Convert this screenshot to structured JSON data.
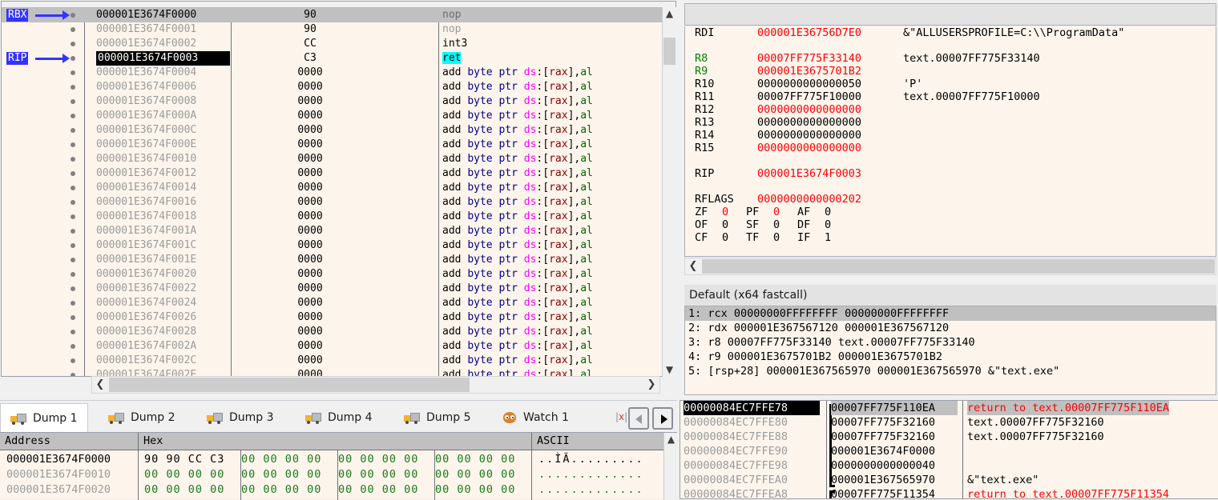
{
  "cpu": {
    "gutter_labels": [
      {
        "text": "RBX",
        "row": 0
      },
      {
        "text": "RIP",
        "row": 3
      }
    ],
    "rows": [
      {
        "addr": "000001E3674F0000",
        "bytes": "90",
        "op": "nop",
        "kind": "nop",
        "state": "selected"
      },
      {
        "addr": "000001E3674F0001",
        "bytes": "90",
        "op": "nop",
        "kind": "nop",
        "state": "normal"
      },
      {
        "addr": "000001E3674F0002",
        "bytes": "CC",
        "op": "int3",
        "kind": "plain",
        "state": "normal"
      },
      {
        "addr": "000001E3674F0003",
        "bytes": "C3",
        "op": "ret",
        "kind": "ret",
        "state": "current"
      },
      {
        "addr": "000001E3674F0004",
        "bytes": "0000",
        "op": "add byte ptr ds:[rax],al",
        "kind": "add",
        "state": "normal"
      },
      {
        "addr": "000001E3674F0006",
        "bytes": "0000",
        "op": "add byte ptr ds:[rax],al",
        "kind": "add",
        "state": "normal"
      },
      {
        "addr": "000001E3674F0008",
        "bytes": "0000",
        "op": "add byte ptr ds:[rax],al",
        "kind": "add",
        "state": "normal"
      },
      {
        "addr": "000001E3674F000A",
        "bytes": "0000",
        "op": "add byte ptr ds:[rax],al",
        "kind": "add",
        "state": "normal"
      },
      {
        "addr": "000001E3674F000C",
        "bytes": "0000",
        "op": "add byte ptr ds:[rax],al",
        "kind": "add",
        "state": "normal"
      },
      {
        "addr": "000001E3674F000E",
        "bytes": "0000",
        "op": "add byte ptr ds:[rax],al",
        "kind": "add",
        "state": "normal"
      },
      {
        "addr": "000001E3674F0010",
        "bytes": "0000",
        "op": "add byte ptr ds:[rax],al",
        "kind": "add",
        "state": "normal"
      },
      {
        "addr": "000001E3674F0012",
        "bytes": "0000",
        "op": "add byte ptr ds:[rax],al",
        "kind": "add",
        "state": "normal"
      },
      {
        "addr": "000001E3674F0014",
        "bytes": "0000",
        "op": "add byte ptr ds:[rax],al",
        "kind": "add",
        "state": "normal"
      },
      {
        "addr": "000001E3674F0016",
        "bytes": "0000",
        "op": "add byte ptr ds:[rax],al",
        "kind": "add",
        "state": "normal"
      },
      {
        "addr": "000001E3674F0018",
        "bytes": "0000",
        "op": "add byte ptr ds:[rax],al",
        "kind": "add",
        "state": "normal"
      },
      {
        "addr": "000001E3674F001A",
        "bytes": "0000",
        "op": "add byte ptr ds:[rax],al",
        "kind": "add",
        "state": "normal"
      },
      {
        "addr": "000001E3674F001C",
        "bytes": "0000",
        "op": "add byte ptr ds:[rax],al",
        "kind": "add",
        "state": "normal"
      },
      {
        "addr": "000001E3674F001E",
        "bytes": "0000",
        "op": "add byte ptr ds:[rax],al",
        "kind": "add",
        "state": "normal"
      },
      {
        "addr": "000001E3674F0020",
        "bytes": "0000",
        "op": "add byte ptr ds:[rax],al",
        "kind": "add",
        "state": "normal"
      },
      {
        "addr": "000001E3674F0022",
        "bytes": "0000",
        "op": "add byte ptr ds:[rax],al",
        "kind": "add",
        "state": "normal"
      },
      {
        "addr": "000001E3674F0024",
        "bytes": "0000",
        "op": "add byte ptr ds:[rax],al",
        "kind": "add",
        "state": "normal"
      },
      {
        "addr": "000001E3674F0026",
        "bytes": "0000",
        "op": "add byte ptr ds:[rax],al",
        "kind": "add",
        "state": "normal"
      },
      {
        "addr": "000001E3674F0028",
        "bytes": "0000",
        "op": "add byte ptr ds:[rax],al",
        "kind": "add",
        "state": "normal"
      },
      {
        "addr": "000001E3674F002A",
        "bytes": "0000",
        "op": "add byte ptr ds:[rax],al",
        "kind": "add",
        "state": "normal"
      },
      {
        "addr": "000001E3674F002C",
        "bytes": "0000",
        "op": "add byte ptr ds:[rax],al",
        "kind": "add",
        "state": "normal"
      },
      {
        "addr": "000001E3674F002E",
        "bytes": "0000",
        "op": "add byte ptr ds:[rax],al",
        "kind": "add",
        "state": "normal"
      }
    ]
  },
  "registers": {
    "rows": [
      {
        "name": "RDI",
        "value": "000001E36756D7E0",
        "comment": "&\"ALLUSERSPROFILE=C:\\\\ProgramData\"",
        "name_mod": false,
        "value_mod": true
      },
      {
        "name": "",
        "value": "",
        "comment": "",
        "name_mod": false,
        "value_mod": false
      },
      {
        "name": "R8",
        "value": "00007FF775F33140",
        "comment": "text.00007FF775F33140",
        "name_mod": true,
        "value_mod": true
      },
      {
        "name": "R9",
        "value": "000001E3675701B2",
        "comment": "",
        "name_mod": true,
        "value_mod": true
      },
      {
        "name": "R10",
        "value": "0000000000000050",
        "comment": "'P'",
        "name_mod": false,
        "value_mod": false
      },
      {
        "name": "R11",
        "value": "00007FF775F10000",
        "comment": "text.00007FF775F10000",
        "name_mod": false,
        "value_mod": false
      },
      {
        "name": "R12",
        "value": "0000000000000000",
        "comment": "",
        "name_mod": false,
        "value_mod": true
      },
      {
        "name": "R13",
        "value": "0000000000000000",
        "comment": "",
        "name_mod": false,
        "value_mod": false
      },
      {
        "name": "R14",
        "value": "0000000000000000",
        "comment": "",
        "name_mod": false,
        "value_mod": false
      },
      {
        "name": "R15",
        "value": "0000000000000000",
        "comment": "",
        "name_mod": false,
        "value_mod": true
      },
      {
        "name": "",
        "value": "",
        "comment": "",
        "name_mod": false,
        "value_mod": false
      },
      {
        "name": "RIP",
        "value": "000001E3674F0003",
        "comment": "",
        "name_mod": false,
        "value_mod": true
      }
    ],
    "rflags_label": "RFLAGS",
    "rflags_value": "0000000000000202",
    "flags": [
      [
        {
          "n": "ZF",
          "v": "0",
          "mod": true
        },
        {
          "n": "PF",
          "v": "0",
          "mod": true
        },
        {
          "n": "AF",
          "v": "0",
          "mod": false
        }
      ],
      [
        {
          "n": "OF",
          "v": "0",
          "mod": false
        },
        {
          "n": "SF",
          "v": "0",
          "mod": false
        },
        {
          "n": "DF",
          "v": "0",
          "mod": false
        }
      ],
      [
        {
          "n": "CF",
          "v": "0",
          "mod": false
        },
        {
          "n": "TF",
          "v": "0",
          "mod": false
        },
        {
          "n": "IF",
          "v": "1",
          "mod": false
        }
      ]
    ]
  },
  "arguments": {
    "title": "Default (x64 fastcall)",
    "rows": [
      {
        "text": "1: rcx 00000000FFFFFFFF  00000000FFFFFFFF",
        "selected": true
      },
      {
        "text": "2: rdx 000001E367567120 000001E367567120",
        "selected": false
      },
      {
        "text": "3: r8 00007FF775F33140 text.00007FF775F33140",
        "selected": false
      },
      {
        "text": "4: r9 000001E3675701B2 000001E3675701B2",
        "selected": false
      },
      {
        "text": "5: [rsp+28] 000001E367565970 000001E367565970 &\"text.exe\"",
        "selected": false
      }
    ]
  },
  "dump_tabs": [
    {
      "label": "Dump 1",
      "icon": "truck-icon",
      "active": true
    },
    {
      "label": "Dump 2",
      "icon": "truck-icon",
      "active": false
    },
    {
      "label": "Dump 3",
      "icon": "truck-icon",
      "active": false
    },
    {
      "label": "Dump 4",
      "icon": "truck-icon",
      "active": false
    },
    {
      "label": "Dump 5",
      "icon": "truck-icon",
      "active": false
    },
    {
      "label": "Watch 1",
      "icon": "owl-icon",
      "active": false
    }
  ],
  "dump": {
    "headers": [
      "Address",
      "Hex",
      "ASCII"
    ],
    "rows": [
      {
        "addr": "000001E3674F0000",
        "groups": [
          {
            "bytes": "90 90 CC C3",
            "black": true,
            "highlight_first": true
          },
          {
            "bytes": "00 00 00 00",
            "black": false
          },
          {
            "bytes": "00 00 00 00",
            "black": false
          },
          {
            "bytes": "00 00 00 00",
            "black": false
          }
        ],
        "ascii": "..ÌÃ.........",
        "ascii_black": true
      },
      {
        "addr": "000001E3674F0010",
        "groups": [
          {
            "bytes": "00 00 00 00",
            "black": false
          },
          {
            "bytes": "00 00 00 00",
            "black": false
          },
          {
            "bytes": "00 00 00 00",
            "black": false
          },
          {
            "bytes": "00 00 00 00",
            "black": false
          }
        ],
        "ascii": ".............",
        "ascii_black": false
      },
      {
        "addr": "000001E3674F0020",
        "groups": [
          {
            "bytes": "00 00 00 00",
            "black": false
          },
          {
            "bytes": "00 00 00 00",
            "black": false
          },
          {
            "bytes": "00 00 00 00",
            "black": false
          },
          {
            "bytes": "00 00 00 00",
            "black": false
          }
        ],
        "ascii": ".............",
        "ascii_black": false
      }
    ]
  },
  "stack": {
    "rows": [
      {
        "addr": "00000084EC7FFE78",
        "value": "00007FF775F110EA",
        "comment": "return to text.00007FF775F110EA",
        "is_return": true,
        "selected": true
      },
      {
        "addr": "00000084EC7FFE80",
        "value": "00007FF775F32160",
        "comment": "text.00007FF775F32160",
        "is_return": false,
        "selected": false
      },
      {
        "addr": "00000084EC7FFE88",
        "value": "00007FF775F32160",
        "comment": "text.00007FF775F32160",
        "is_return": false,
        "selected": false
      },
      {
        "addr": "00000084EC7FFE90",
        "value": "000001E3674F0000",
        "comment": "",
        "is_return": false,
        "selected": false
      },
      {
        "addr": "00000084EC7FFE98",
        "value": "0000000000000040",
        "comment": "",
        "is_return": false,
        "selected": false
      },
      {
        "addr": "00000084EC7FFEA0",
        "value": "000001E367565970",
        "comment": "&\"text.exe\"",
        "is_return": false,
        "selected": false
      },
      {
        "addr": "00000084EC7FFEA8",
        "value": "00007FF775F11354",
        "comment": "return to text.00007FF775F11354",
        "is_return": true,
        "selected": false
      }
    ]
  },
  "colors": {
    "bg_code": "#fdf5ec",
    "selection_gray": "#c0c0c0",
    "current_black": "#000000",
    "ret_highlight": "#00ffff",
    "modified_red": "#ff0000",
    "modified_green": "#008000",
    "gutter_blue": "#3333ff",
    "hex_green": "#1a7a1a"
  }
}
